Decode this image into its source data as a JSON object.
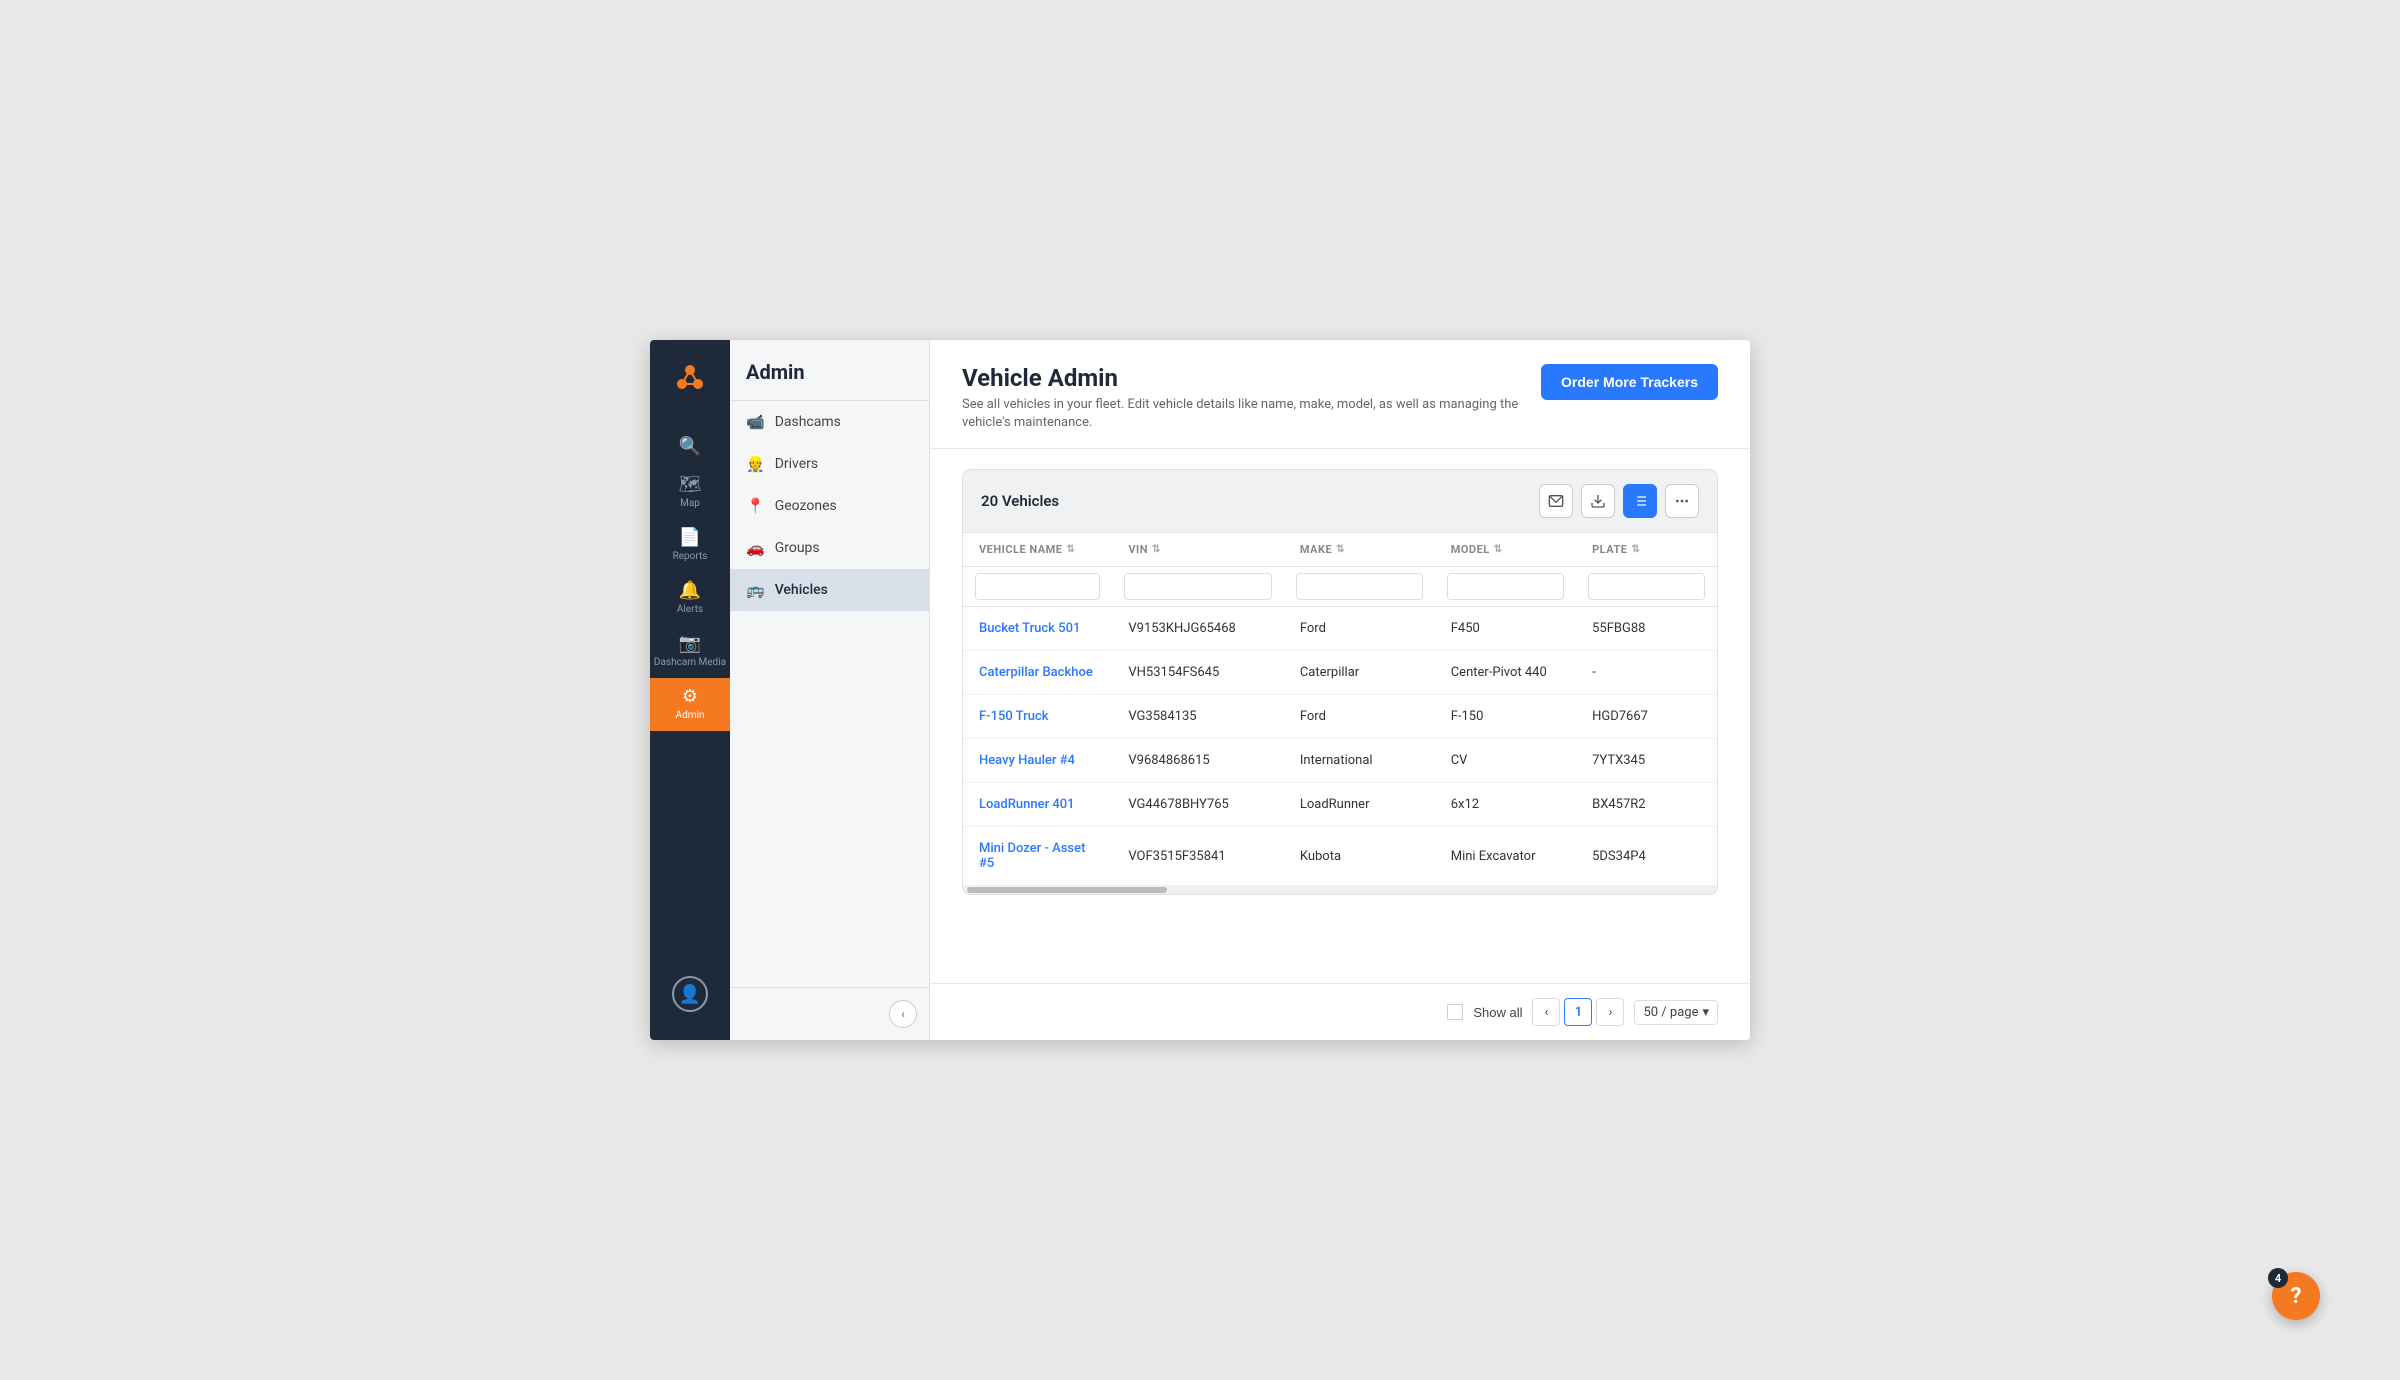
{
  "app": {
    "window_title": "Vehicle Admin"
  },
  "left_nav": {
    "logo_alt": "Logo",
    "items": [
      {
        "id": "search",
        "icon": "🔍",
        "label": ""
      },
      {
        "id": "map",
        "icon": "🗺",
        "label": "Map"
      },
      {
        "id": "reports",
        "icon": "📄",
        "label": "Reports"
      },
      {
        "id": "alerts",
        "icon": "🔔",
        "label": "Alerts"
      },
      {
        "id": "dashcam",
        "icon": "📷",
        "label": "Dashcam Media"
      },
      {
        "id": "admin",
        "icon": "⚙",
        "label": "Admin"
      }
    ],
    "user_icon": "👤"
  },
  "sidebar": {
    "title": "Admin",
    "items": [
      {
        "id": "dashcams",
        "label": "Dashcams",
        "icon": "📹"
      },
      {
        "id": "drivers",
        "label": "Drivers",
        "icon": "👷"
      },
      {
        "id": "geozones",
        "label": "Geozones",
        "icon": "📍"
      },
      {
        "id": "groups",
        "label": "Groups",
        "icon": "🚗"
      },
      {
        "id": "vehicles",
        "label": "Vehicles",
        "icon": "🚌"
      }
    ]
  },
  "main": {
    "page_title": "Vehicle Admin",
    "page_subtitle": "See all vehicles in your fleet. Edit vehicle details like name, make, model, as well as managing the vehicle's maintenance.",
    "order_button": "Order More Trackers",
    "table": {
      "count_label": "20 Vehicles",
      "columns": [
        {
          "key": "vehicle_name",
          "label": "VEHICLE NAME"
        },
        {
          "key": "vin",
          "label": "VIN"
        },
        {
          "key": "make",
          "label": "MAKE"
        },
        {
          "key": "model",
          "label": "MODEL"
        },
        {
          "key": "plate",
          "label": "PLATE"
        }
      ],
      "rows": [
        {
          "vehicle_name": "Bucket Truck 501",
          "vin": "V9153KHJG65468",
          "make": "Ford",
          "model": "F450",
          "plate": "55FBG88"
        },
        {
          "vehicle_name": "Caterpillar Backhoe",
          "vin": "VH53154FS645",
          "make": "Caterpillar",
          "model": "Center-Pivot 440",
          "plate": "-"
        },
        {
          "vehicle_name": "F-150 Truck",
          "vin": "VG3584135",
          "make": "Ford",
          "model": "F-150",
          "plate": "HGD7667"
        },
        {
          "vehicle_name": "Heavy Hauler #4",
          "vin": "V9684868615",
          "make": "International",
          "model": "CV",
          "plate": "7YTX345"
        },
        {
          "vehicle_name": "LoadRunner 401",
          "vin": "VG44678BHY765",
          "make": "LoadRunner",
          "model": "6x12",
          "plate": "BX457R2"
        },
        {
          "vehicle_name": "Mini Dozer - Asset #5",
          "vin": "VOF3515F35841",
          "make": "Kubota",
          "model": "Mini Excavator",
          "plate": "5DS34P4"
        }
      ]
    },
    "pagination": {
      "show_all": "Show all",
      "current_page": "1",
      "per_page": "50 / page"
    }
  },
  "help": {
    "badge_count": "4",
    "icon": "?"
  }
}
